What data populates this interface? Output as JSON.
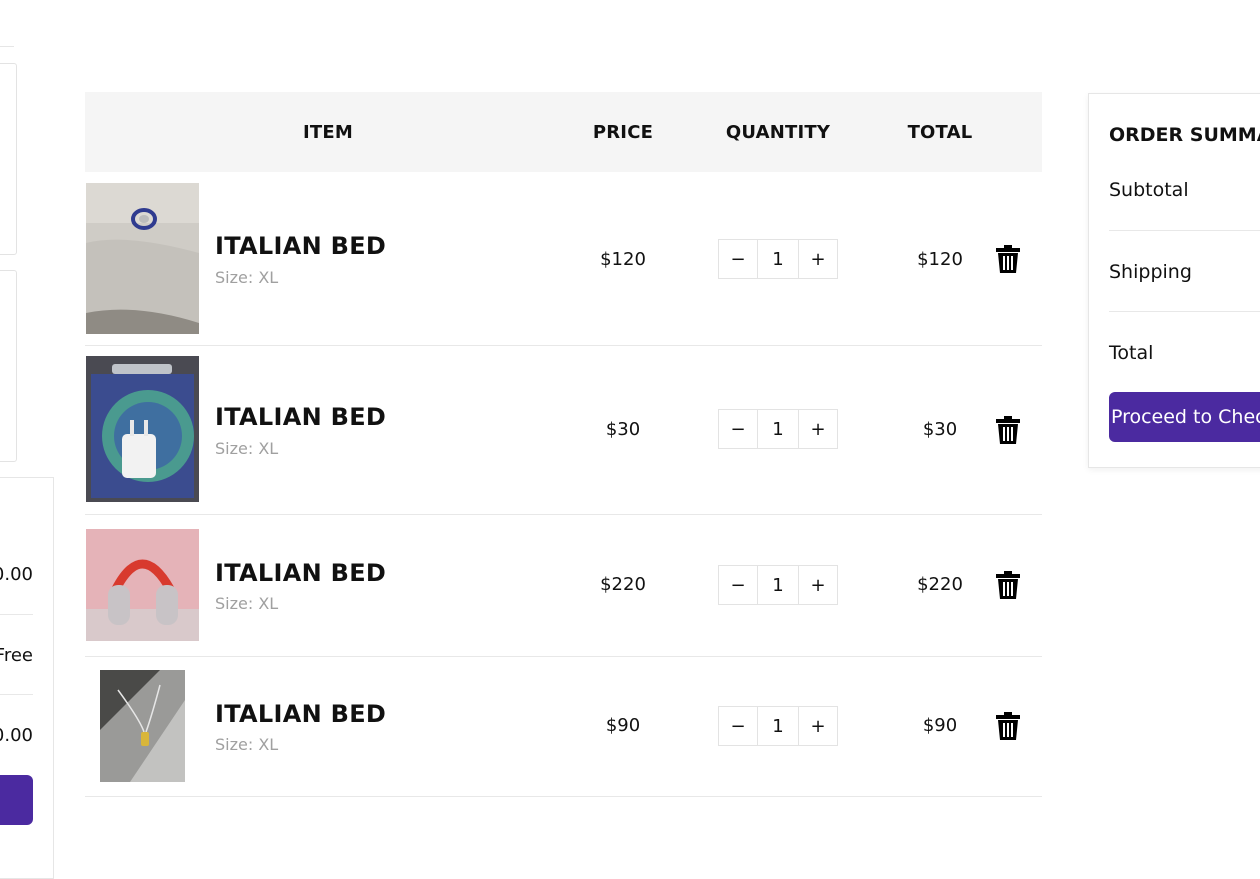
{
  "left_panel": {
    "subtotal_value": "0.00",
    "shipping_value": "Free",
    "total_value": "0.00"
  },
  "table": {
    "headers": {
      "item": "ITEM",
      "price": "PRICE",
      "quantity": "QUANTITY",
      "total": "TOTAL"
    },
    "rows": [
      {
        "name": "ITALIAN BED",
        "size": "Size: XL",
        "price": "$120",
        "quantity": "1",
        "total": "$120",
        "image": "ring-photo"
      },
      {
        "name": "ITALIAN BED",
        "size": "Size: XL",
        "price": "$30",
        "quantity": "1",
        "total": "$30",
        "image": "charger-photo"
      },
      {
        "name": "ITALIAN BED",
        "size": "Size: XL",
        "price": "$220",
        "quantity": "1",
        "total": "$220",
        "image": "headphones-photo"
      },
      {
        "name": "ITALIAN BED",
        "size": "Size: XL",
        "price": "$90",
        "quantity": "1",
        "total": "$90",
        "image": "necklace-photo"
      }
    ],
    "decrement_symbol": "−",
    "increment_symbol": "+"
  },
  "summary": {
    "title": "ORDER SUMMARY",
    "subtotal_label": "Subtotal",
    "shipping_label": "Shipping",
    "total_label": "Total",
    "checkout_label": "Proceed to Checkout"
  },
  "colors": {
    "accent": "#4b2aa0",
    "header_bg": "#f5f5f5",
    "muted_text": "#a0a0a0"
  },
  "icons": [
    "trash-icon",
    "minus-icon",
    "plus-icon"
  ]
}
